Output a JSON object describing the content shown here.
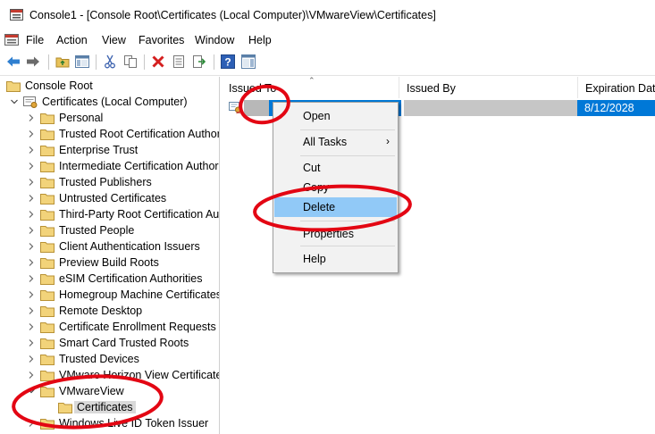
{
  "window": {
    "title": "Console1 - [Console Root\\Certificates (Local Computer)\\VMwareView\\Certificates]"
  },
  "menu": {
    "items": [
      "File",
      "Action",
      "View",
      "Favorites",
      "Window",
      "Help"
    ]
  },
  "toolbar": {
    "icons": [
      "back-arrow-icon",
      "forward-arrow-icon",
      "up-folder-icon",
      "show-hide-tree-icon",
      "cut-icon",
      "copy-icon",
      "delete-icon",
      "properties-icon",
      "export-list-icon",
      "help-icon",
      "show-action-pane-icon"
    ]
  },
  "tree": {
    "root": "Console Root",
    "store": "Certificates (Local Computer)",
    "folders": [
      "Personal",
      "Trusted Root Certification Authorities",
      "Enterprise Trust",
      "Intermediate Certification Authorities",
      "Trusted Publishers",
      "Untrusted Certificates",
      "Third-Party Root Certification Authorities",
      "Trusted People",
      "Client Authentication Issuers",
      "Preview Build Roots",
      "eSIM Certification Authorities",
      "Homegroup Machine Certificates",
      "Remote Desktop",
      "Certificate Enrollment Requests",
      "Smart Card Trusted Roots",
      "Trusted Devices",
      "VMware Horizon View Certificates",
      "VMwareView",
      "Certificates",
      "Windows Live ID Token Issuer"
    ]
  },
  "list": {
    "columns": [
      "Issued To",
      "Issued By",
      "Expiration Date"
    ],
    "rows": [
      {
        "issued_to": "",
        "issued_by": "",
        "expiration": "8/12/2028"
      }
    ]
  },
  "context_menu": {
    "items": [
      "Open",
      "All Tasks",
      "Cut",
      "Copy",
      "Delete",
      "Properties",
      "Help"
    ],
    "highlighted": "Delete"
  },
  "colors": {
    "selection_blue": "#0078d7",
    "menu_highlight": "#91c9f7",
    "annotation_red": "#e30613",
    "folder_yellow": "#e8c25a"
  }
}
